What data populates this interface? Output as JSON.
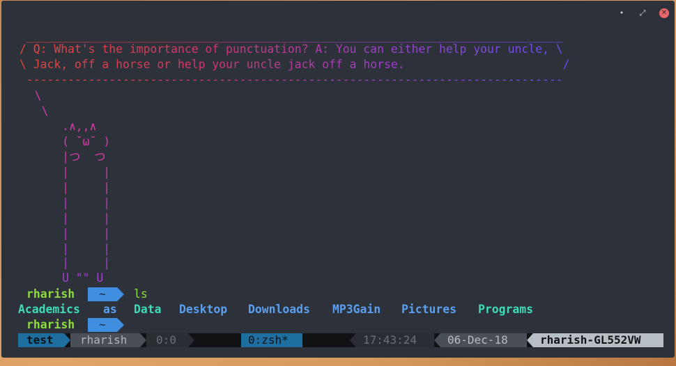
{
  "window": {
    "controls": {
      "minimize": "•",
      "restore": "⤢",
      "close": "✕"
    }
  },
  "terminal": {
    "speech_bubble": {
      "top_border": " ______________________________________________________________________________",
      "line1": "/ Q: What's the importance of punctuation? A: You can either help your uncle, \\",
      "line2": "\\ Jack, off a horse or help your uncle jack off a horse.                       /",
      "bottom_border": " ------------------------------------------------------------------------------"
    },
    "cat_art": [
      "   \\",
      "    \\",
      "       .∧,,∧",
      "       ( ˘ω˘ )",
      "       |つ  つ",
      "       |     |",
      "       |     |",
      "       |     |",
      "       |     |",
      "       |     |",
      "       |     |",
      "       |     |",
      "       U \"\" U"
    ],
    "prompt1": {
      "user": "rharish",
      "dir": "~",
      "command": "ls"
    },
    "ls_output": [
      {
        "name": "Academics",
        "kind": "green"
      },
      {
        "name": "as",
        "kind": "blue"
      },
      {
        "name": "Data",
        "kind": "green"
      },
      {
        "name": "Desktop",
        "kind": "blue"
      },
      {
        "name": "Downloads",
        "kind": "blue"
      },
      {
        "name": "MP3Gain",
        "kind": "blue"
      },
      {
        "name": "Pictures",
        "kind": "blue"
      },
      {
        "name": "Programs",
        "kind": "green"
      }
    ],
    "prompt2": {
      "user": "rharish",
      "dir": "~"
    }
  },
  "statusbar": {
    "session": "test",
    "user": "rharish",
    "pane": "0:0",
    "window": "0:zsh*",
    "time": "17:43:24",
    "date": "06-Dec-18",
    "host": "rharish-GL552VW"
  },
  "colors": {
    "terminal_bg": "#2c313a",
    "accent_blue": "#3f8ee0",
    "user_green": "#8fdc3f",
    "dir_green": "#3fdcb4",
    "dir_blue": "#5b9ff0",
    "cat_pink": "#d63aa8"
  }
}
